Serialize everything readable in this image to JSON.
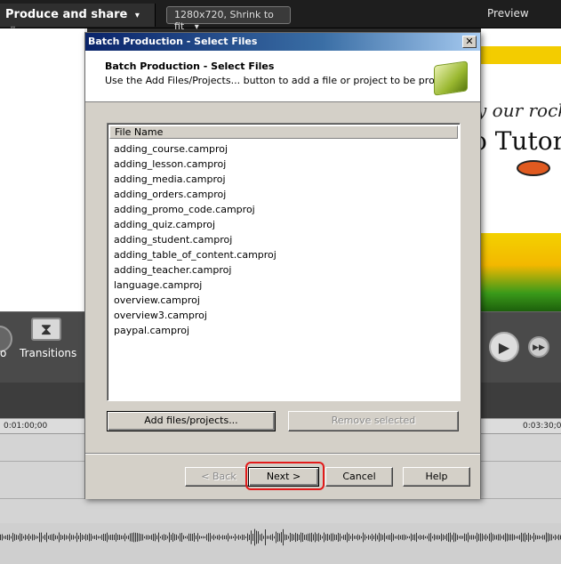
{
  "app": {
    "produce_label": "Produce and share",
    "produce_caret": "▾",
    "produce_option": "▿",
    "size_select": "1280x720, Shrink to fit",
    "size_caret": "▾",
    "preview_label": "Preview",
    "preview_text_1": "y our rock",
    "preview_text_2": "o Tutor",
    "tools": [
      {
        "label": "o",
        "icon": "clip-icon"
      },
      {
        "label": "Transitions",
        "icon": "transitions-icon"
      }
    ],
    "timeline": {
      "time_left": "0:01:00;00",
      "time_right": "0:03:30;0"
    },
    "play_glyph": "▶",
    "ff_glyph": "▶▶",
    "transitions_glyph": "⧗"
  },
  "dialog": {
    "title": "Batch Production - Select Files",
    "close_glyph": "✕",
    "header_title": "Batch Production - Select Files",
    "header_subtitle": "Use the Add Files/Projects... button to add a file or project to be produced.",
    "list_header": "File Name",
    "files": [
      "adding_course.camproj",
      "adding_lesson.camproj",
      "adding_media.camproj",
      "adding_orders.camproj",
      "adding_promo_code.camproj",
      "adding_quiz.camproj",
      "adding_student.camproj",
      "adding_table_of_content.camproj",
      "adding_teacher.camproj",
      "language.camproj",
      "overview.camproj",
      "overview3.camproj",
      "paypal.camproj"
    ],
    "add_button": "Add files/projects...",
    "remove_button": "Remove selected",
    "back_button": "< Back",
    "next_button": "Next >",
    "cancel_button": "Cancel",
    "help_button": "Help",
    "highlight_color": "#e21a1a"
  }
}
